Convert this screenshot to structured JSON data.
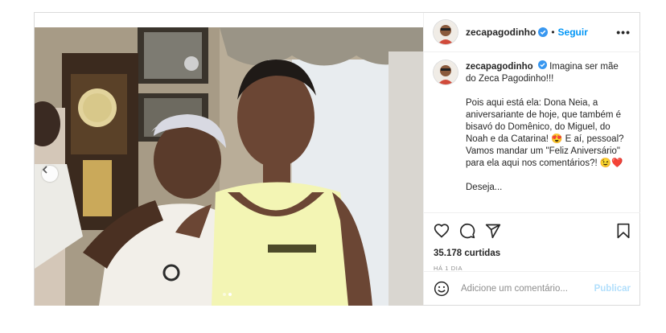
{
  "post": {
    "username": "zecapagodinho",
    "follow_label": "Seguir",
    "bullet": "•",
    "more_label": "•••",
    "caption_intro": "Imagina ser mãe do Zeca Pagodinho!!!",
    "caption_paragraph": "Pois aqui está ela: Dona Neia, a aniversariante de hoje, que também é bisavó do Domênico, do Miguel, do Noah e da Catarina! 😍 E aí, pessoal? Vamos mandar um \"Feliz Aniversário\" para ela aqui nos comentários?! 😉❤️",
    "caption_cut": "Deseja...",
    "likes": "35.178 curtidas",
    "time_ago": "HÁ 1 DIA",
    "comment_placeholder": "Adicione um comentário...",
    "publish_label": "Publicar"
  },
  "carousel": {
    "current": 2,
    "total": 2
  },
  "icons": {
    "verified": "verified-badge-icon",
    "like": "heart-icon",
    "comment": "comment-icon",
    "share": "share-icon",
    "save": "bookmark-icon",
    "emoji": "emoji-icon",
    "prev": "chevron-left-icon"
  },
  "colors": {
    "link": "#0095f6",
    "verified": "#3897f0",
    "muted": "#8e8e8e",
    "publish_disabled": "#b2dffc"
  }
}
